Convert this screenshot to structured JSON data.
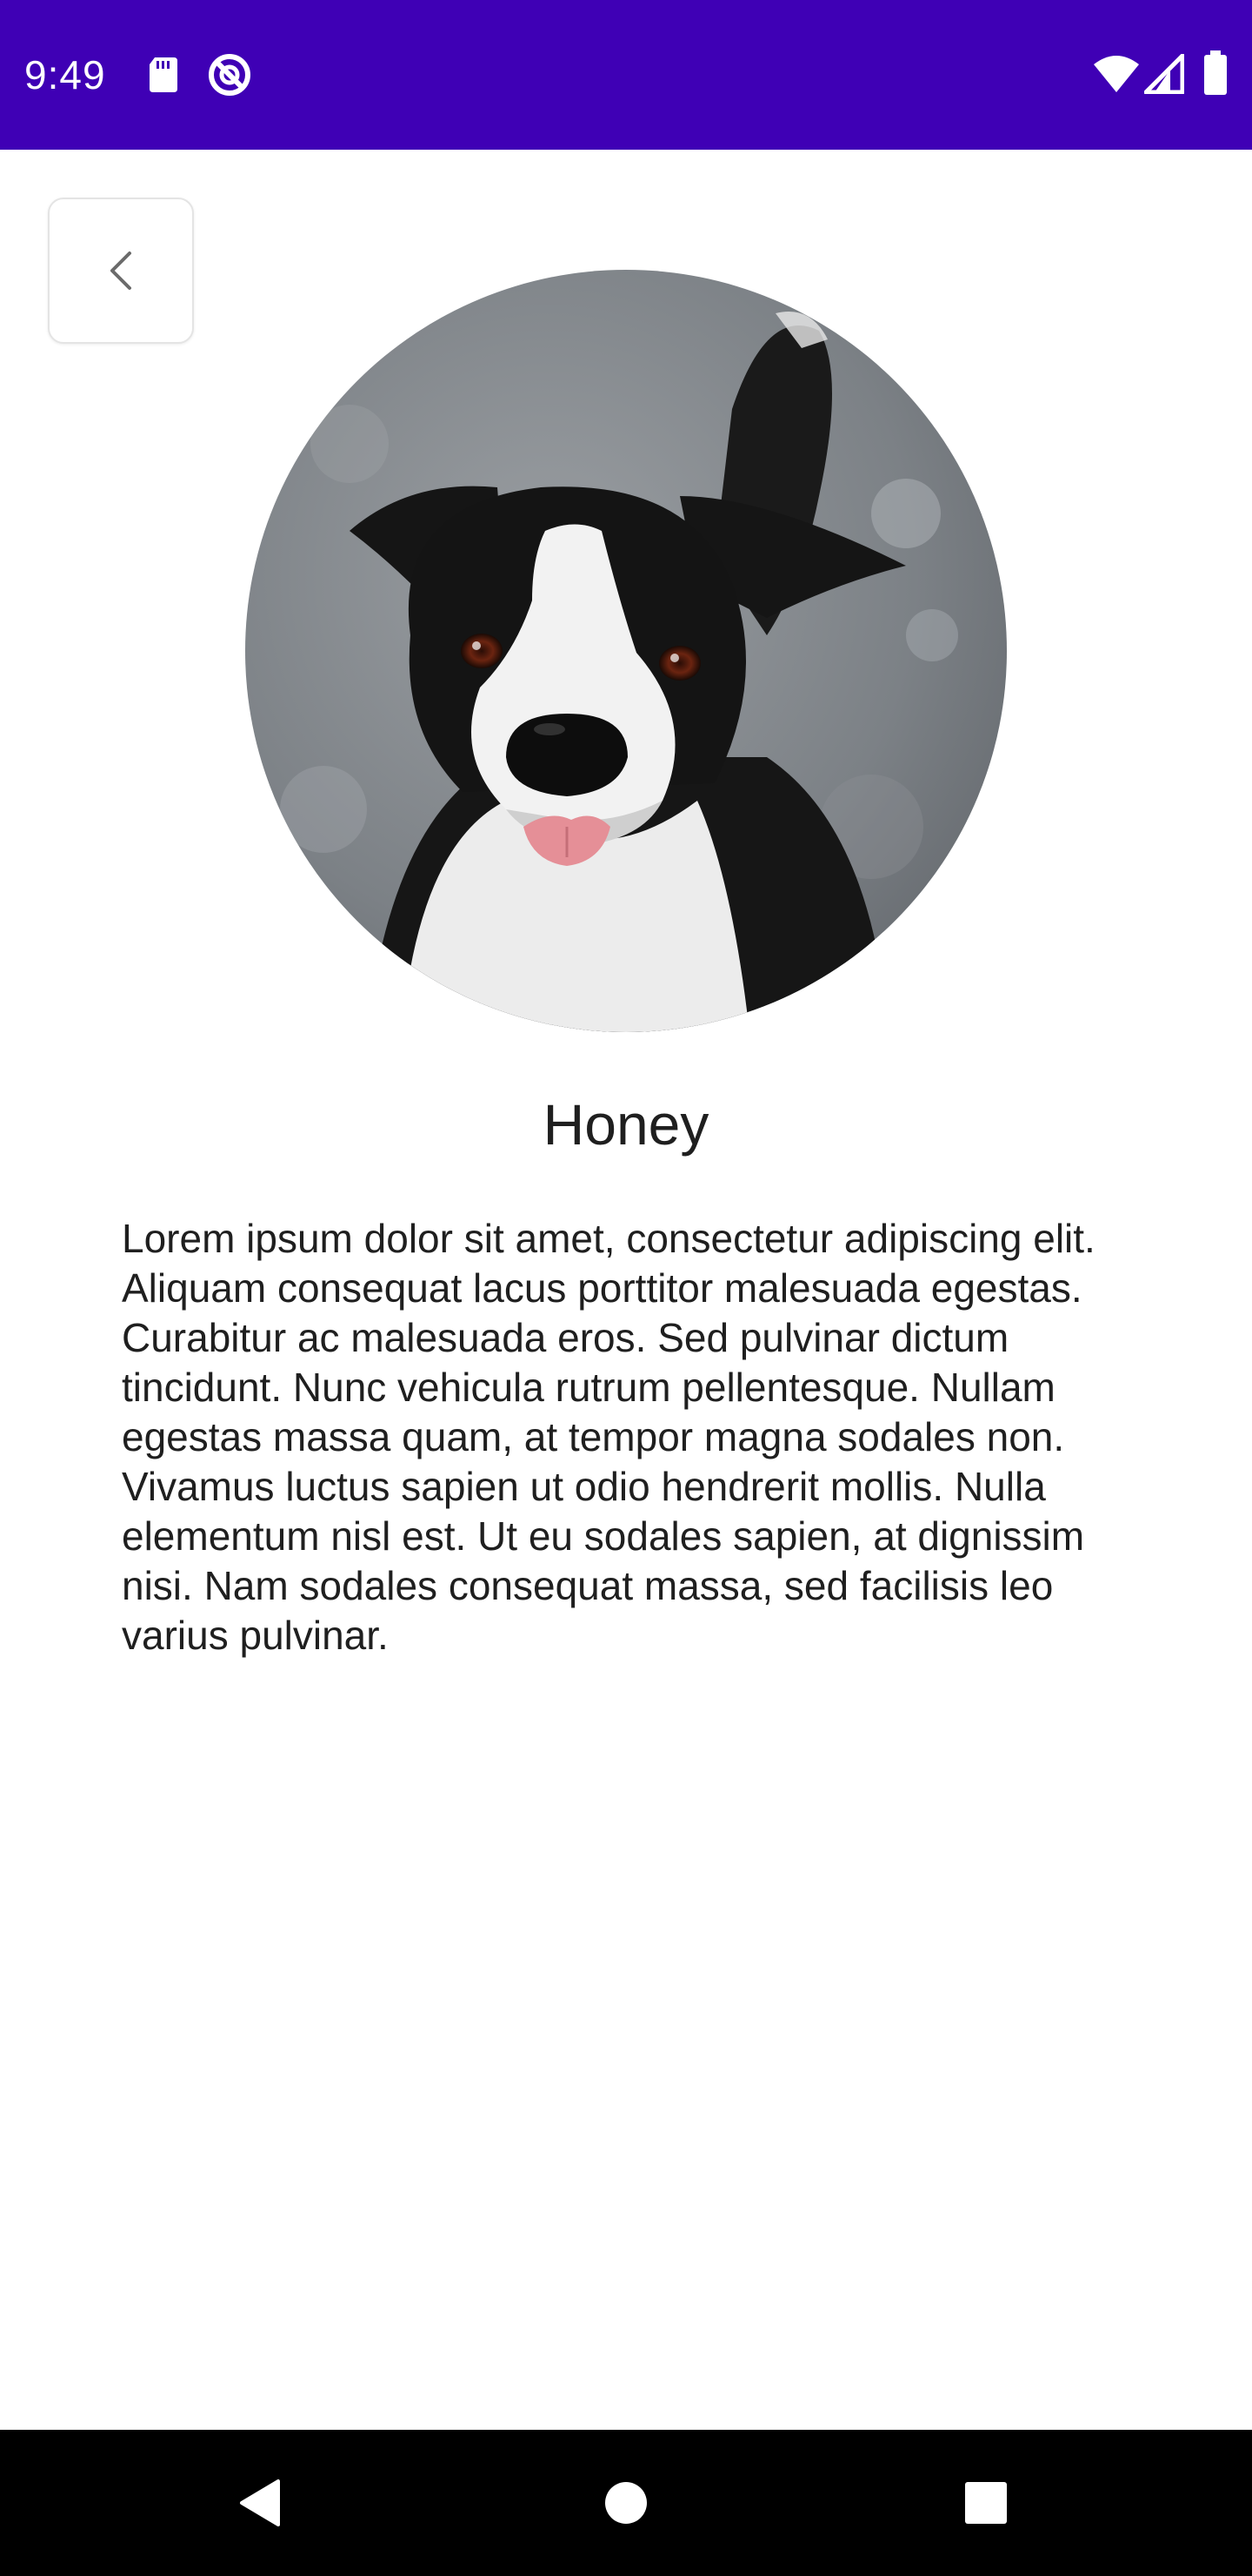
{
  "status_bar": {
    "time": "9:49",
    "background_color": "#3f00b5",
    "icons_left": [
      "sd-card-icon",
      "no-disturb-icon"
    ],
    "icons_right": [
      "wifi-icon",
      "cell-signal-icon",
      "battery-icon"
    ]
  },
  "toolbar": {
    "back_icon": "chevron-left-icon"
  },
  "pet": {
    "photo_description_icon": "dog-photo",
    "name": "Honey",
    "description": "Lorem ipsum dolor sit amet, consectetur adipiscing elit. Aliquam consequat lacus porttitor malesuada egestas. Curabitur ac malesuada eros. Sed pulvinar dictum tincidunt. Nunc vehicula rutrum pellentesque. Nullam egestas massa quam, at tempor magna sodales non. Vivamus luctus sapien ut odio hendrerit mollis. Nulla elementum nisl est. Ut eu sodales sapien, at dignissim nisi. Nam sodales consequat massa, sed facilisis leo varius pulvinar."
  },
  "nav_bar": {
    "buttons": [
      "back-triangle-icon",
      "home-circle-icon",
      "recents-square-icon"
    ]
  }
}
